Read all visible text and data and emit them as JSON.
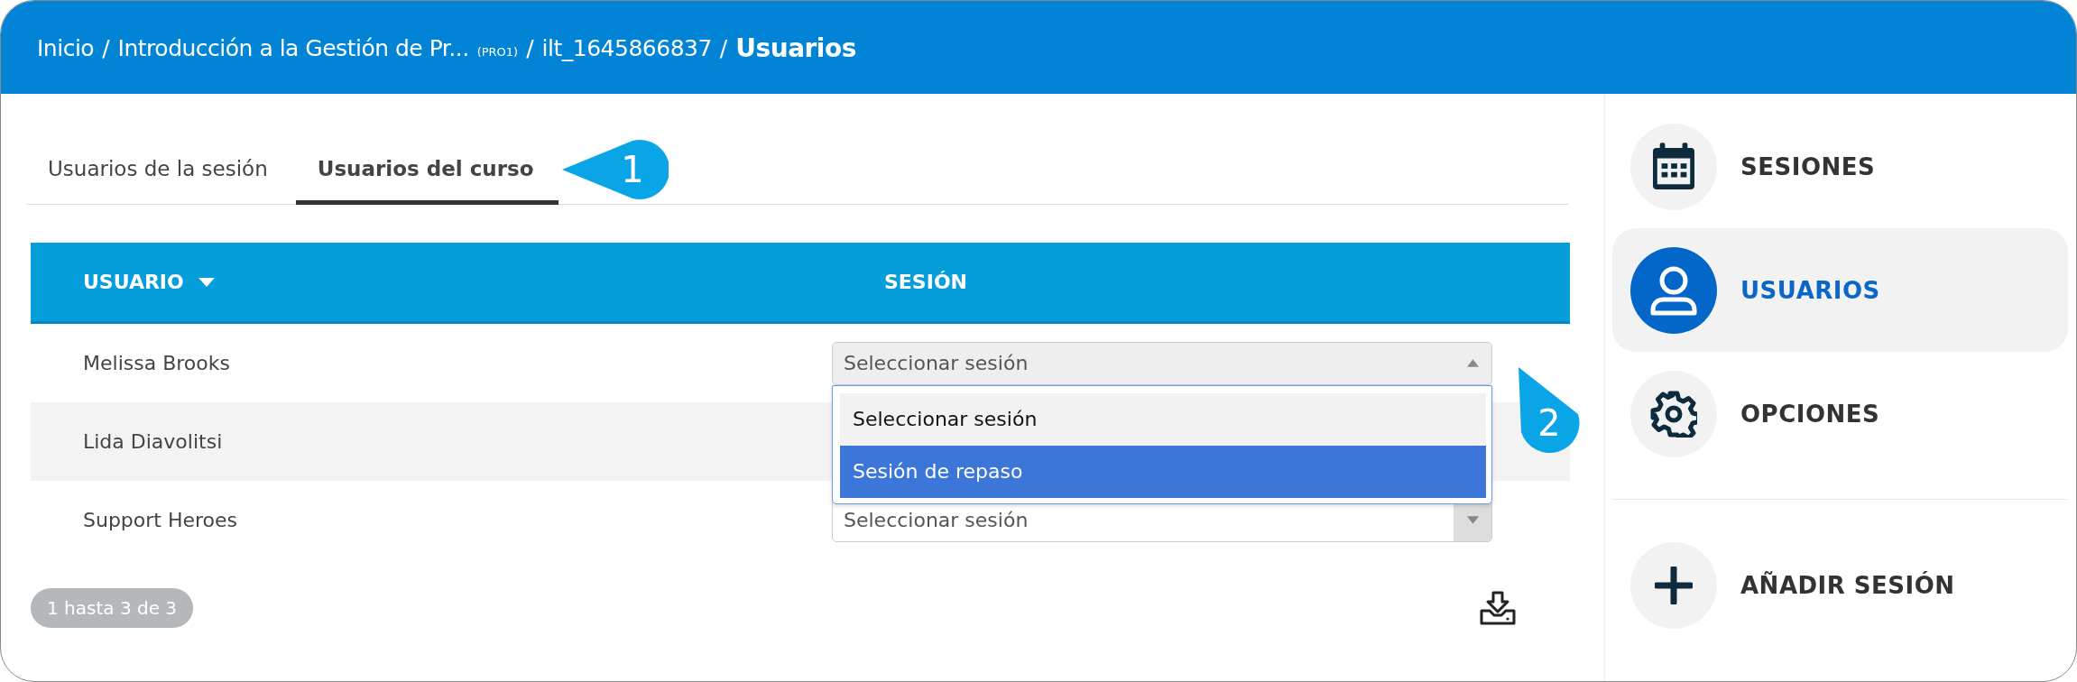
{
  "breadcrumb_separator": "/",
  "breadcrumb": [
    {
      "label": "Inicio",
      "current": false
    },
    {
      "label": "Introducción a la Gestión de Pr...",
      "suffix": "(PRO1)",
      "current": false
    },
    {
      "label": "ilt_1645866837",
      "current": false
    },
    {
      "label": "Usuarios",
      "current": true
    }
  ],
  "tabs": [
    {
      "label": "Usuarios de la sesión",
      "selected": false
    },
    {
      "label": "Usuarios del curso",
      "selected": true
    }
  ],
  "callouts": [
    "1",
    "2"
  ],
  "table": {
    "columns": [
      {
        "label": "USUARIO",
        "sorted": true
      },
      {
        "label": "SESIÓN",
        "sorted": false
      }
    ],
    "rows": [
      {
        "user": "Melissa Brooks",
        "session": {
          "value": "Seleccionar sesión",
          "open": true,
          "options": [
            {
              "label": "Seleccionar sesión",
              "selected": true,
              "highlighted": false
            },
            {
              "label": "Sesión de repaso",
              "selected": false,
              "highlighted": true
            }
          ]
        }
      },
      {
        "user": "Lida Diavolitsi"
      },
      {
        "user": "Support Heroes",
        "session": {
          "value": "Seleccionar sesión",
          "open": false
        }
      }
    ]
  },
  "pagination": "1 hasta 3 de 3",
  "sidebar": {
    "items": [
      {
        "label": "SESIONES",
        "kind": "nav",
        "selected": false
      },
      {
        "label": "USUARIOS",
        "kind": "nav",
        "selected": true
      },
      {
        "label": "OPCIONES",
        "kind": "nav",
        "selected": false
      },
      {
        "label": "AÑADIR SESIÓN",
        "kind": "action",
        "selected": false
      }
    ]
  }
}
